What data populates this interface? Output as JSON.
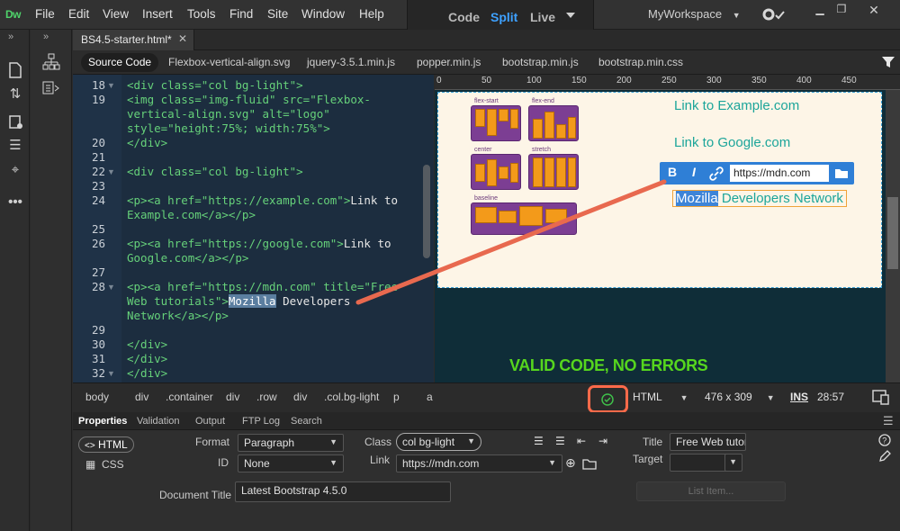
{
  "app": {
    "logo": "Dw",
    "menu": [
      "File",
      "Edit",
      "View",
      "Insert",
      "Tools",
      "Find",
      "Site",
      "Window",
      "Help"
    ],
    "view_modes": [
      "Code",
      "Split",
      "Live"
    ],
    "active_view": "Split",
    "workspace": "MyWorkspace"
  },
  "document": {
    "tab": "BS4.5-starter.html*",
    "related_files": [
      "Source Code",
      "Flexbox-vertical-align.svg",
      "jquery-3.5.1.min.js",
      "popper.min.js",
      "bootstrap.min.js",
      "bootstrap.min.css"
    ]
  },
  "code": {
    "lines": [
      {
        "n": "18",
        "fold": "▼",
        "text": "<div class=\"col bg-light\">"
      },
      {
        "n": "19",
        "fold": "",
        "text": "<img class=\"img-fluid\" src=\"Flexbox-"
      },
      {
        "n": "",
        "fold": "",
        "text": "vertical-align.svg\" alt=\"logo\""
      },
      {
        "n": "",
        "fold": "",
        "text": "style=\"height:75%; width:75%\">"
      },
      {
        "n": "20",
        "fold": "",
        "text": "</div>"
      },
      {
        "n": "21",
        "fold": "",
        "text": ""
      },
      {
        "n": "22",
        "fold": "▼",
        "text": "<div class=\"col bg-light\">"
      },
      {
        "n": "23",
        "fold": "",
        "text": ""
      },
      {
        "n": "24",
        "fold": "",
        "text": "<p><a href=\"https://example.com\">Link to"
      },
      {
        "n": "",
        "fold": "",
        "text": "Example.com</a></p>"
      },
      {
        "n": "25",
        "fold": "",
        "text": ""
      },
      {
        "n": "26",
        "fold": "",
        "text": "<p><a href=\"https://google.com\">Link to"
      },
      {
        "n": "",
        "fold": "",
        "text": "Google.com</a></p>"
      },
      {
        "n": "27",
        "fold": "",
        "text": ""
      },
      {
        "n": "28",
        "fold": "▼",
        "text": "<p><a href=\"https://mdn.com\" title=\"Free"
      },
      {
        "n": "",
        "fold": "",
        "text": "Web tutorials\">Mozilla Developers"
      },
      {
        "n": "",
        "fold": "",
        "text": "Network</a></p>"
      },
      {
        "n": "29",
        "fold": "",
        "text": ""
      },
      {
        "n": "30",
        "fold": "",
        "text": "</div>"
      },
      {
        "n": "31",
        "fold": "",
        "text": "</div>"
      },
      {
        "n": "32",
        "fold": "▼",
        "text": "</div>"
      }
    ]
  },
  "design": {
    "ruler_ticks": [
      "0",
      "50",
      "100",
      "150",
      "200",
      "250",
      "300",
      "350",
      "400",
      "450"
    ],
    "thumb_labels": [
      "flex-start",
      "flex-end",
      "center",
      "stretch",
      "baseline"
    ],
    "links": [
      "Link to Example.com",
      "Link to Google.com"
    ],
    "mdn_link_selected": "Mozilla",
    "mdn_link_rest": " Developers Network",
    "property_toolbar": {
      "bold": "B",
      "italic": "I",
      "url": "https://mdn.com"
    }
  },
  "annotation": {
    "text": "VALID CODE, NO ERRORS",
    "color": "#56d61e",
    "arrow_color": "#e8694f"
  },
  "tag_selector": {
    "crumbs": [
      "body",
      "div",
      ".container",
      "div",
      ".row",
      "div",
      ".col.bg-light",
      "p",
      "a"
    ],
    "language": "HTML",
    "window_size": "476 x 309",
    "insert_mode": "INS",
    "cursor_pos": "28:57"
  },
  "properties": {
    "tabs": [
      "Properties",
      "Validation",
      "Output",
      "FTP Log",
      "Search"
    ],
    "html_btn": "HTML",
    "css_btn": "CSS",
    "format_label": "Format",
    "format_value": "Paragraph",
    "id_label": "ID",
    "id_value": "None",
    "class_label": "Class",
    "class_value": "col bg-light",
    "link_label": "Link",
    "link_value": "https://mdn.com",
    "title_label": "Title",
    "title_value": "Free Web tutori",
    "target_label": "Target",
    "target_value": "",
    "doc_title_label": "Document Title",
    "doc_title_value": "Latest Bootstrap 4.5.0",
    "list_item_btn": "List Item..."
  }
}
